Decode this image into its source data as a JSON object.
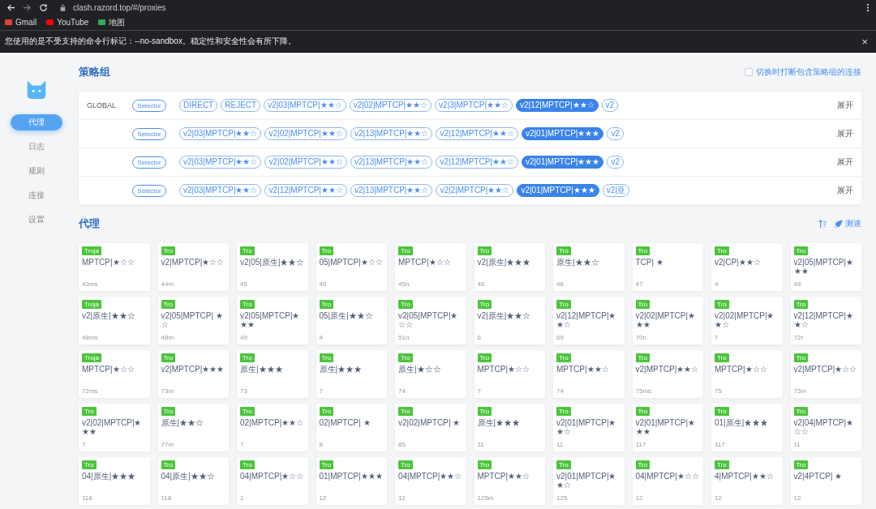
{
  "browser": {
    "url": "clash.razord.top/#/proxies",
    "bookmarks": [
      "Gmail",
      "YouTube",
      "地图"
    ]
  },
  "warning": {
    "text": "您使用的是不受支持的命令行标记：--no-sandbox。稳定性和安全性会有所下降。",
    "close": "×"
  },
  "sidebar": {
    "items": [
      {
        "label": "代理",
        "selected": true
      },
      {
        "label": "日志",
        "selected": false
      },
      {
        "label": "规则",
        "selected": false
      },
      {
        "label": "连接",
        "selected": false
      },
      {
        "label": "设置",
        "selected": false
      }
    ]
  },
  "groups_section": {
    "title": "策略组",
    "option": {
      "label": "切换时打断包含策略组的连接",
      "checked": false
    }
  },
  "groups": [
    {
      "name": "GLOBAL",
      "type": "Selector",
      "expand": "展开",
      "proxies": [
        {
          "label": "DIRECT",
          "selected": false
        },
        {
          "label": "REJECT",
          "selected": false
        },
        {
          "label": "v2|03|MPTCP|★★☆",
          "selected": false
        },
        {
          "label": "v2|02|MPTCP|★★☆",
          "selected": false
        },
        {
          "label": "v2|3|MPTCP|★★☆",
          "selected": false
        },
        {
          "label": "v2|12|MPTCP|★★☆",
          "selected": true
        },
        {
          "label": "v2",
          "selected": false
        }
      ]
    },
    {
      "type": "Selector",
      "expand": "展开",
      "proxies": [
        {
          "label": "v2|03|MPTCP|★★☆",
          "selected": false
        },
        {
          "label": "v2|02|MPTCP|★★☆",
          "selected": false
        },
        {
          "label": "v2|13|MPTCP|★★☆",
          "selected": false
        },
        {
          "label": "v2|12|MPTCP|★★☆",
          "selected": false
        },
        {
          "label": "v2|01|MPTCP|★★★",
          "selected": true
        },
        {
          "label": "v2",
          "selected": false
        }
      ]
    },
    {
      "type": "Selector",
      "expand": "展开",
      "proxies": [
        {
          "label": "v2|03|MPTCP|★★☆",
          "selected": false
        },
        {
          "label": "v2|02|MPTCP|★★☆",
          "selected": false
        },
        {
          "label": "v2|13|MPTCP|★★☆",
          "selected": false
        },
        {
          "label": "v2|12|MPTCP|★★☆",
          "selected": false
        },
        {
          "label": "v2|01|MPTCP|★★★",
          "selected": true
        },
        {
          "label": "v2",
          "selected": false
        }
      ]
    },
    {
      "type": "Selector",
      "expand": "展开",
      "proxies": [
        {
          "label": "v2|03|MPTCP|★★☆",
          "selected": false
        },
        {
          "label": "v2|12|MPTCP|★★☆",
          "selected": false
        },
        {
          "label": "v2|13|MPTCP|★★☆",
          "selected": false
        },
        {
          "label": "v2|2|MPTCP|★★☆",
          "selected": false
        },
        {
          "label": "v2|01|MPTCP|★★★",
          "selected": true
        },
        {
          "label": "v2|亚",
          "selected": false
        }
      ]
    }
  ],
  "proxies_section": {
    "title": "代理",
    "speedtest": "测速"
  },
  "proxies": [
    {
      "tag": "Troja",
      "name": "MPTCP|★☆☆",
      "delay": "43ms"
    },
    {
      "tag": "Tro",
      "name": "v2|MPTCP|★☆☆",
      "delay": "44m"
    },
    {
      "tag": "Tro",
      "name": "v2|05|原生|★★☆",
      "delay": "45"
    },
    {
      "tag": "Tro",
      "name": "05|MPTCP|★☆☆",
      "delay": "45"
    },
    {
      "tag": "Tro",
      "name": "MPTCP|★☆☆",
      "delay": "45n"
    },
    {
      "tag": "Tro",
      "name": "v2|原生|★★★",
      "delay": "46"
    },
    {
      "tag": "Tro",
      "name": "原生|★★☆",
      "delay": "46"
    },
    {
      "tag": "Tro",
      "name": "TCP| ★",
      "delay": "47"
    },
    {
      "tag": "Tro",
      "name": "v2|CP|★★☆",
      "delay": "4"
    },
    {
      "tag": "Tro",
      "name": "v2|05|MPTCP|★★★",
      "delay": "48"
    },
    {
      "tag": "Troja",
      "name": "v2|原生|★★☆",
      "delay": "48ms"
    },
    {
      "tag": "Tro",
      "name": "v2|05|MPTCP| ★☆",
      "delay": "48m"
    },
    {
      "tag": "Tro",
      "name": "v2|05|MPTCP|★★★",
      "delay": "49"
    },
    {
      "tag": "Tro",
      "name": "05|原生|★★☆",
      "delay": "4"
    },
    {
      "tag": "Tro",
      "name": "v2|05|MPTCP|★☆☆",
      "delay": "51n"
    },
    {
      "tag": "Tro",
      "name": "v2|原生|★★☆",
      "delay": "6"
    },
    {
      "tag": "Tro",
      "name": "v2|12|MPTCP|★★☆",
      "delay": "69"
    },
    {
      "tag": "Tro",
      "name": "v2|02|MPTCP|★★★",
      "delay": "70n"
    },
    {
      "tag": "Tro",
      "name": "v2|02|MPTCP|★★☆",
      "delay": "7"
    },
    {
      "tag": "Tro",
      "name": "v2|12|MPTCP|★★☆",
      "delay": "72r"
    },
    {
      "tag": "Troja",
      "name": "MPTCP|★☆☆",
      "delay": "72ms"
    },
    {
      "tag": "Tro",
      "name": "v2|MPTCP|★★★",
      "delay": "73m"
    },
    {
      "tag": "Tro",
      "name": "原生|★★★",
      "delay": "73"
    },
    {
      "tag": "Tro",
      "name": "原生|★★★",
      "delay": "7"
    },
    {
      "tag": "Tro",
      "name": "原生|★☆☆",
      "delay": "74"
    },
    {
      "tag": "Tro",
      "name": "MPTCP|★☆☆",
      "delay": "7"
    },
    {
      "tag": "Tro",
      "name": "MPTCP|★★☆",
      "delay": "74"
    },
    {
      "tag": "Tro",
      "name": "v2|MPTCP|★★☆",
      "delay": "75ms"
    },
    {
      "tag": "Tro",
      "name": "MPTCP|★☆☆",
      "delay": "75"
    },
    {
      "tag": "Tro",
      "name": "v2|MPTCP|★☆☆",
      "delay": "75m"
    },
    {
      "tag": "Tro",
      "name": "v2|02|MPTCP|★★★",
      "delay": "7"
    },
    {
      "tag": "Tro",
      "name": "原生|★★☆",
      "delay": "77m"
    },
    {
      "tag": "Tro",
      "name": "02|MPTCP|★★☆",
      "delay": "7"
    },
    {
      "tag": "Tro",
      "name": "02|MPTCP| ★",
      "delay": "8"
    },
    {
      "tag": "Tro",
      "name": "v2|02|MPTCP| ★",
      "delay": "85"
    },
    {
      "tag": "Tro",
      "name": "原生|★★★",
      "delay": "11"
    },
    {
      "tag": "Tro",
      "name": "v2|01|MPTCP|★★☆",
      "delay": "11"
    },
    {
      "tag": "Tro",
      "name": "v2|01|MPTCP|★★★",
      "delay": "117"
    },
    {
      "tag": "Tro",
      "name": "01|原生|★★★",
      "delay": "117"
    },
    {
      "tag": "Tro",
      "name": "v2|04|MPTCP|★☆☆",
      "delay": "11"
    },
    {
      "tag": "Tro",
      "name": "04|原生|★★★",
      "delay": "118"
    },
    {
      "tag": "Tro",
      "name": "04|原生|★★☆",
      "delay": "118"
    },
    {
      "tag": "Tro",
      "name": "04|MPTCP|★☆☆",
      "delay": "1"
    },
    {
      "tag": "Tro",
      "name": "01|MPTCP|★★★",
      "delay": "12"
    },
    {
      "tag": "Tro",
      "name": "04|MPTCP|★★☆",
      "delay": "12"
    },
    {
      "tag": "Tro",
      "name": "MPTCP|★★☆",
      "delay": "125m"
    },
    {
      "tag": "Tro",
      "name": "v2|01|MPTCP|★★☆",
      "delay": "125"
    },
    {
      "tag": "Tro",
      "name": "04|MPTCP|★☆☆",
      "delay": "12"
    },
    {
      "tag": "Tro",
      "name": "4|MPTCP|★★☆",
      "delay": "12"
    },
    {
      "tag": "Tro",
      "name": "v2|4PTCP| ★",
      "delay": "12"
    }
  ]
}
